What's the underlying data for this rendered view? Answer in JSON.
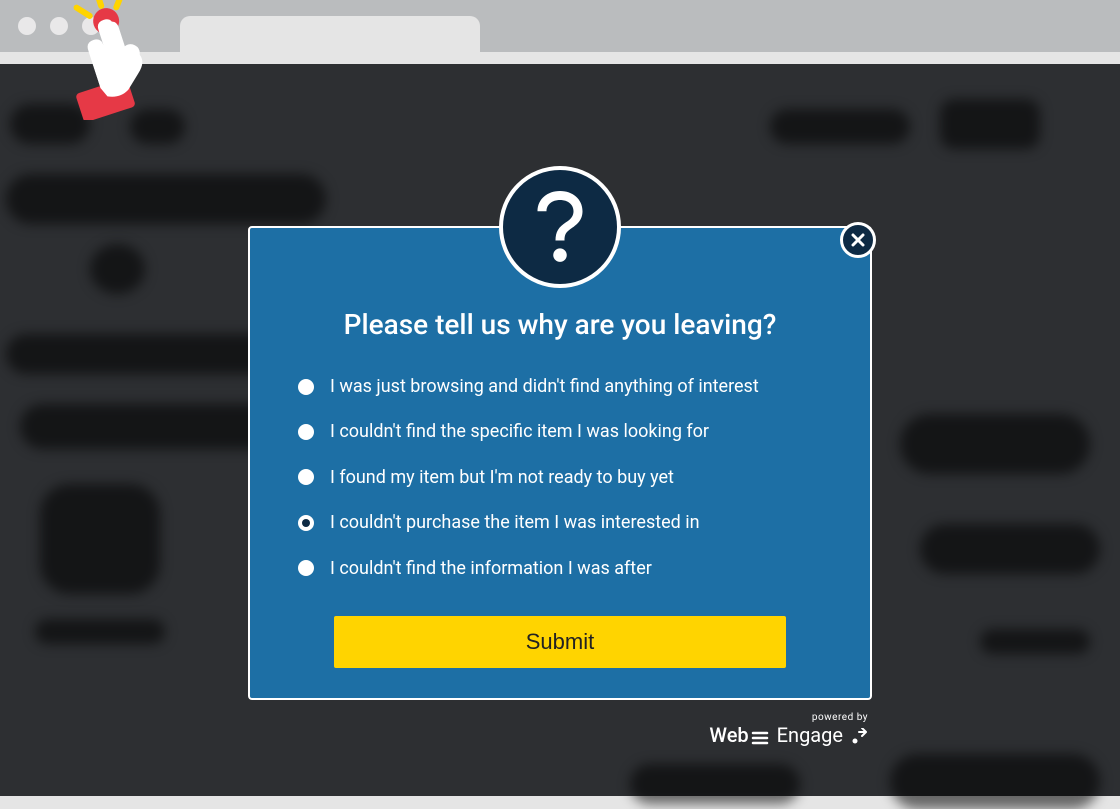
{
  "modal": {
    "title": "Please tell us why are you leaving?",
    "options": [
      {
        "label": "I was just browsing and didn't find anything of interest",
        "selected": false
      },
      {
        "label": "I couldn't find the specific item I was looking for",
        "selected": false
      },
      {
        "label": "I found my item but I'm not ready to buy yet",
        "selected": false
      },
      {
        "label": "I couldn't purchase the item I was interested in",
        "selected": true
      },
      {
        "label": "I couldn't find the information I was after",
        "selected": false
      }
    ],
    "submit_label": "Submit"
  },
  "footer": {
    "powered_by_prefix": "powered by",
    "brand_web": "Web",
    "brand_engage": "Engage"
  }
}
